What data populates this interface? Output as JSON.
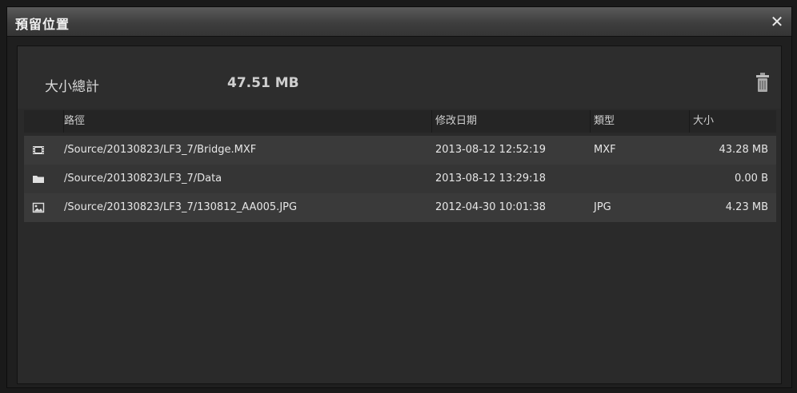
{
  "window": {
    "title": "預留位置",
    "close_label": "✕"
  },
  "summary": {
    "label": "大小總計",
    "value": "47.51 MB"
  },
  "table": {
    "columns": [
      "路徑",
      "修改日期",
      "類型",
      "大小"
    ],
    "rows": [
      {
        "icon": "video-clip-icon",
        "path": "/Source/20130823/LF3_7/Bridge.MXF",
        "date": "2013-08-12 12:52:19",
        "type": "MXF",
        "size": "43.28 MB"
      },
      {
        "icon": "folder-icon",
        "path": "/Source/20130823/LF3_7/Data",
        "date": "2013-08-12 13:29:18",
        "type": "",
        "size": "0.00 B"
      },
      {
        "icon": "image-file-icon",
        "path": "/Source/20130823/LF3_7/130812_AA005.JPG",
        "date": "2012-04-30 10:01:38",
        "type": "JPG",
        "size": "4.23 MB"
      }
    ]
  },
  "colors": {
    "titlebar": "#4a4a4a",
    "panel": "#2a2a2a",
    "row_odd": "#3a3a3a",
    "row_even": "#353535",
    "text": "#e6e6e6"
  }
}
